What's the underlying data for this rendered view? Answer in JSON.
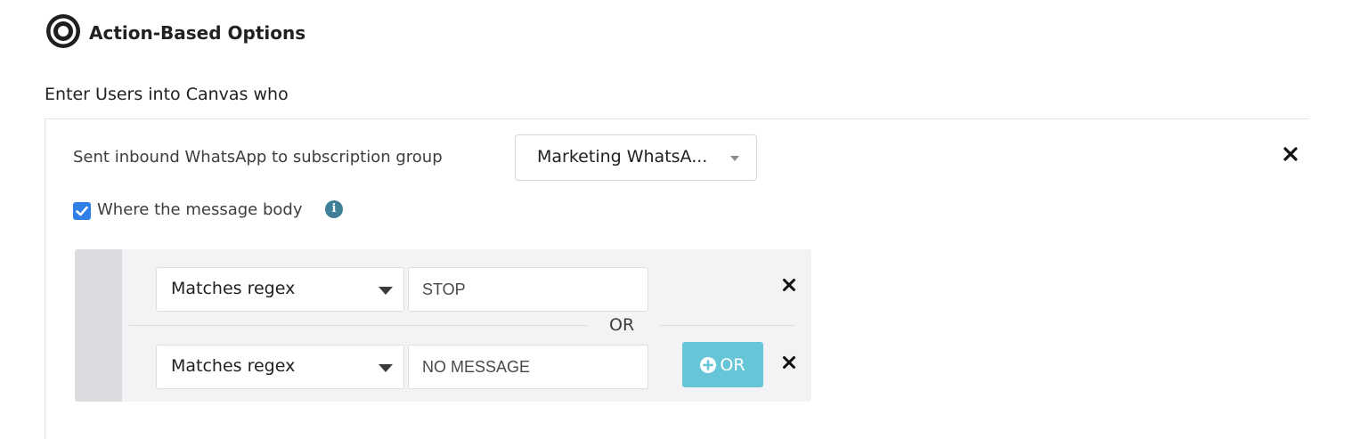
{
  "header": {
    "title": "Action-Based Options",
    "icon": "target-icon"
  },
  "section": {
    "label": "Enter Users into Canvas who"
  },
  "trigger": {
    "text": "Sent inbound WhatsApp to subscription group",
    "subscription_group": "Marketing WhatsA...",
    "remove_icon": "close-icon"
  },
  "message_body_filter": {
    "checkbox_label": "Where the message body",
    "checked": true,
    "info_icon": "info-icon",
    "info_glyph": "i"
  },
  "filters": {
    "rows": [
      {
        "operator": "Matches regex",
        "value": "STOP"
      },
      {
        "operator": "Matches regex",
        "value": "NO MESSAGE"
      }
    ],
    "separator": "OR",
    "add_or_label": "OR"
  },
  "colors": {
    "checkbox": "#2f7fe6",
    "info": "#3f8098",
    "add_or_button": "#66c6d8",
    "filter_background": "#f3f3f5",
    "filter_bar": "#dcdce0"
  }
}
